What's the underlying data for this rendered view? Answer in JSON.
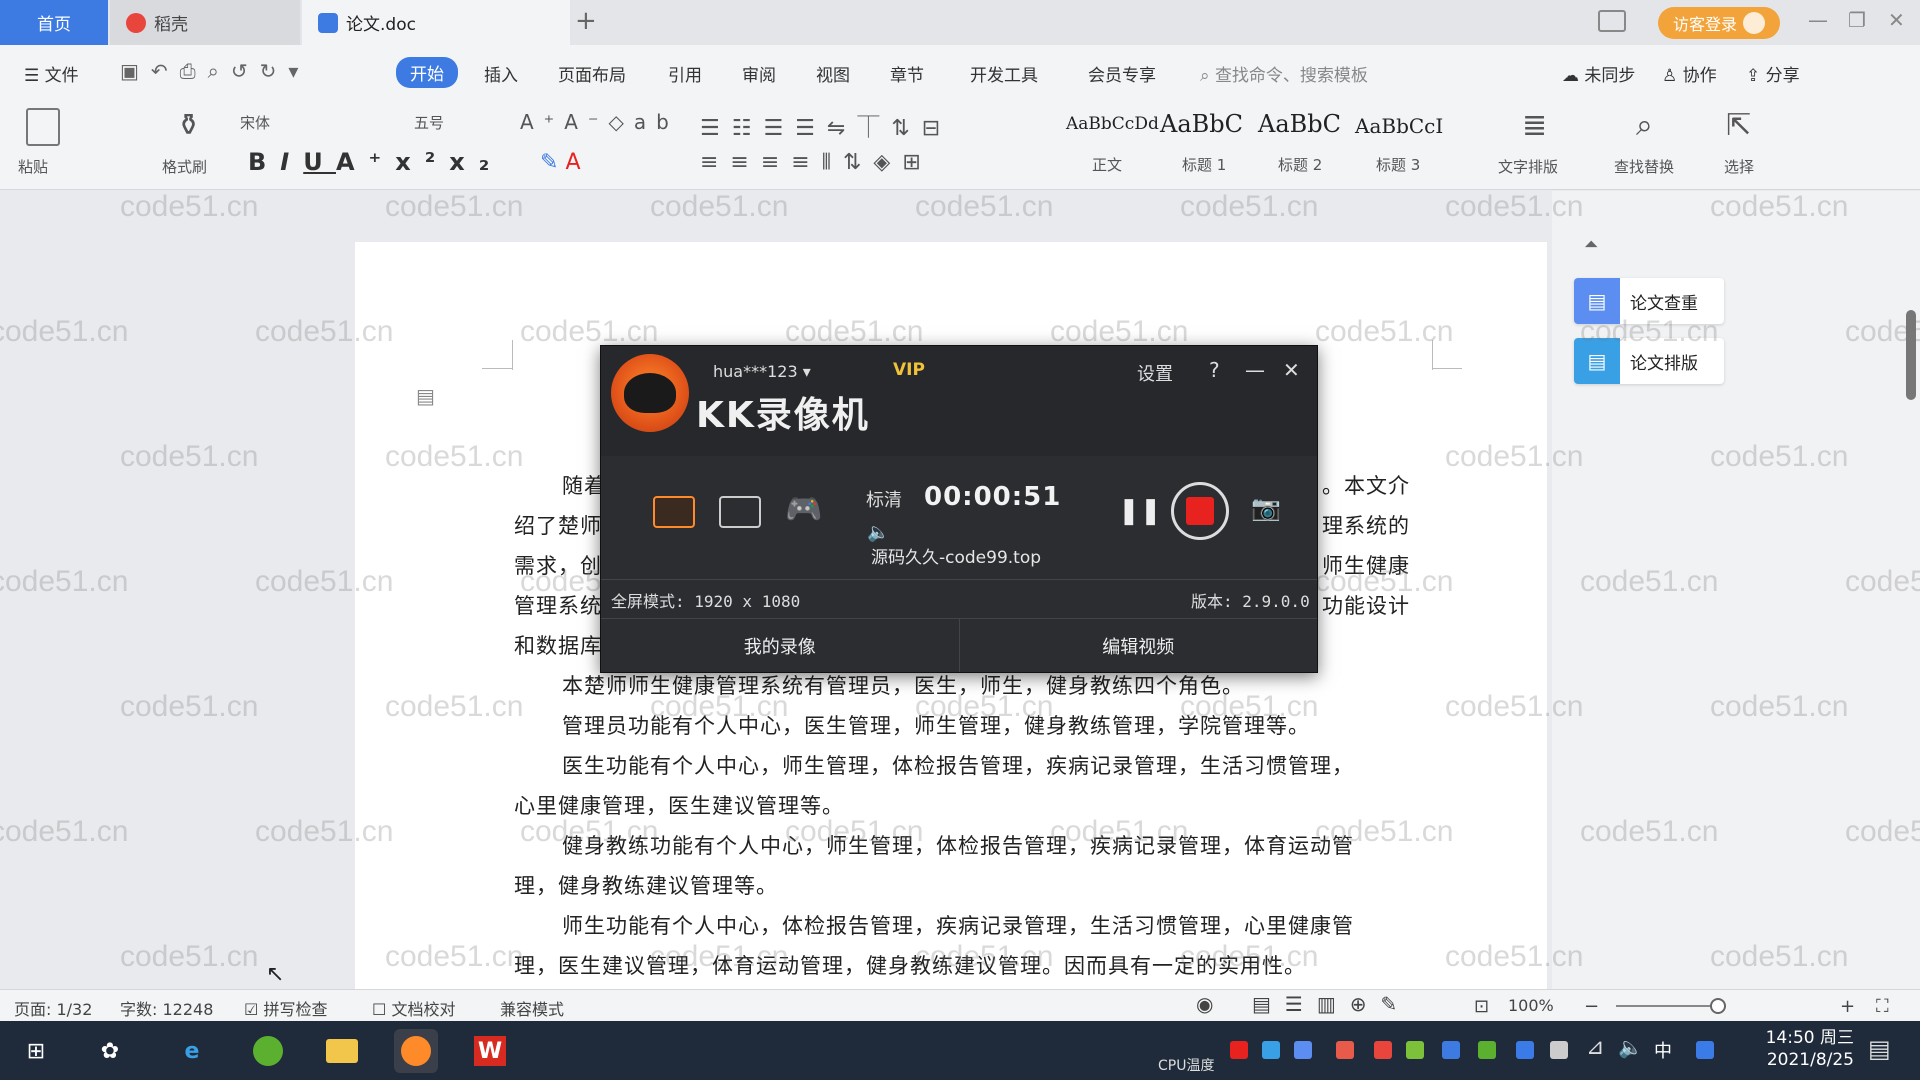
{
  "tabs": {
    "home": "首页",
    "daoke": "稻壳",
    "doc": "论文.doc",
    "plus": "+",
    "login": "访客登录"
  },
  "menu": {
    "file": "文件",
    "items": [
      "开始",
      "插入",
      "页面布局",
      "引用",
      "审阅",
      "视图",
      "章节",
      "开发工具",
      "会员专享"
    ],
    "search": "查找命令、搜索模板",
    "sync": "未同步",
    "collab": "协作",
    "share": "分享"
  },
  "ribbon": {
    "paste": "粘贴",
    "format_painter": "格式刷",
    "font": "宋体",
    "size": "五号",
    "styles": [
      {
        "sample": "AaBbCcDd",
        "caption": "正文"
      },
      {
        "sample": "AaBbC",
        "caption": "标题 1"
      },
      {
        "sample": "AaBbC",
        "caption": "标题 2"
      },
      {
        "sample": "AaBbCcI",
        "caption": "标题 3"
      }
    ],
    "text_layout": "文字排版",
    "find_replace": "查找替换",
    "select": "选择"
  },
  "document": {
    "lines": [
      "随着",
      "。本文介",
      "绍了楚师",
      "理系统的",
      "需求，创",
      "师生健康",
      "管理系统",
      "功能设计",
      "和数据库",
      "本楚师师生健康管理系统有管理员，医生，师生，健身教练四个角色。",
      "管理员功能有个人中心，医生管理，师生管理，健身教练管理，学院管理等。",
      "医生功能有个人中心，师生管理，体检报告管理，疾病记录管理，生活习惯管理，",
      "心里健康管理，医生建议管理等。",
      "健身教练功能有个人中心，师生管理，体检报告管理，疾病记录管理，体育运动管",
      "理，健身教练建议管理等。",
      "师生功能有个人中心，体检报告管理，疾病记录管理，生活习惯管理，心里健康管",
      "理，医生建议管理，体育运动管理，健身教练建议管理。因而具有一定的实用性。"
    ],
    "watermark": "code51.cn"
  },
  "right_panel": {
    "check": "论文查重",
    "layout": "论文排版"
  },
  "kk": {
    "user": "hua***123",
    "vip": "VIP",
    "title": "KK录像机",
    "settings": "设置",
    "help": "?",
    "quality": "标清",
    "timer": "00:00:51",
    "watermark": "源码久久-code99.top",
    "mode": "全屏模式: 1920 x 1080",
    "version": "版本: 2.9.0.0",
    "my_videos": "我的录像",
    "edit_video": "编辑视频"
  },
  "status": {
    "page": "页面: 1/32",
    "words": "字数: 12248",
    "spell": "拼写检查",
    "proof": "文档校对",
    "compat": "兼容模式",
    "zoom": "100%"
  },
  "taskbar": {
    "time": "14:50 周三",
    "date": "2021/8/25",
    "cpu": "CPU温度",
    "ime": "中"
  },
  "colors": {
    "accent": "#3d7be3",
    "record_red": "#e8231f",
    "kk_orange": "#ff8a2a",
    "vip_gold": "#f0c23a",
    "login_orange": "#f2a33a"
  }
}
